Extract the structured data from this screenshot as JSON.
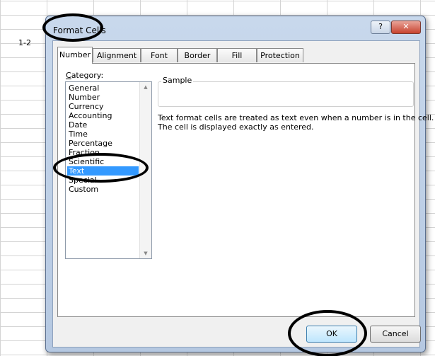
{
  "sheet": {
    "cell_text": "1-2"
  },
  "dialog": {
    "title": "Format Cells",
    "help_label": "?",
    "close_label": "✕",
    "tabs": [
      {
        "label": "Number"
      },
      {
        "label": "Alignment"
      },
      {
        "label": "Font"
      },
      {
        "label": "Border"
      },
      {
        "label": "Fill"
      },
      {
        "label": "Protection"
      }
    ],
    "active_tab": "Number",
    "category": {
      "label_prefix": "",
      "label_underlined": "C",
      "label_rest": "ategory:",
      "items": [
        {
          "label": "General"
        },
        {
          "label": "Number"
        },
        {
          "label": "Currency"
        },
        {
          "label": "Accounting"
        },
        {
          "label": "Date"
        },
        {
          "label": "Time"
        },
        {
          "label": "Percentage"
        },
        {
          "label": "Fraction"
        },
        {
          "label": "Scientific"
        },
        {
          "label": "Text"
        },
        {
          "label": "Special"
        },
        {
          "label": "Custom"
        }
      ],
      "selected": "Text"
    },
    "sample_label": "Sample",
    "description": [
      "Text format cells are treated as text even when a number is in the cell.",
      "The cell is displayed exactly as entered."
    ],
    "ok_label": "OK",
    "cancel_label": "Cancel"
  },
  "colors": {
    "selection": "#3399ff",
    "dialog_frame": "#b5c8e1",
    "close_button": "#c8432f"
  }
}
